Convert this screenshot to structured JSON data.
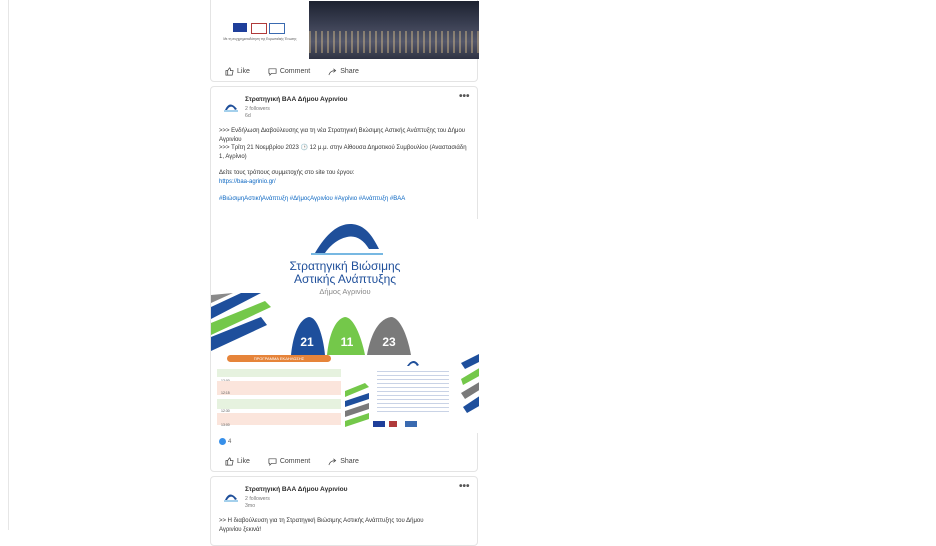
{
  "prev_post": {
    "banner_caption": "Με τη συγχρηματοδότηση της Ευρωπαϊκής Ένωσης",
    "actions": {
      "like": "Like",
      "comment": "Comment",
      "share": "Share"
    }
  },
  "post1": {
    "author": "Στρατηγική ΒΑΑ Δήμου Αγρινίου",
    "followers": "2 followers",
    "time": "6d",
    "menu": "•••",
    "lines": [
      ">>> Ενδήλωση Διαβούλευσης για τη νέα Στρατηγική Βιώσιμης Αστικής Ανάπτυξης του Δήμου Αγρινίου",
      ">>> Τρίτη 21 Νοεμβρίου 2023 🕒 12 μ.μ. στην Αίθουσα Δημοτικού Συμβουλίου (Αναστασιάδη 1, Αγρίνιο)",
      "Δείτε τους τρόπους συμμετοχής στο site του έργου:"
    ],
    "link": "https://baa-agrinio.gr/",
    "hashtags": "#ΒιώσιμηΑστικήΑνάπτυξη #ΔήμοςΑγρινίου #Αγρίνιο #Ανάπτυξη #ΒΑΑ",
    "image": {
      "title_line1": "Στρατηγική Βιώσιμης",
      "title_line2": "Αστικής Ανάπτυξης",
      "subtitle": "Δήμος Αγρινίου",
      "date_badges": [
        "21",
        "11",
        "23"
      ],
      "program_header": "ΠΡΟΓΡΑΜΜΑ ΕΚΔΗΛΩΣΗΣ",
      "program_rows": [
        "12:00",
        "12:15",
        "12:30",
        "13:00"
      ]
    },
    "reactions_count": "4",
    "actions": {
      "like": "Like",
      "comment": "Comment",
      "share": "Share"
    }
  },
  "post2": {
    "author": "Στρατηγική ΒΑΑ Δήμου Αγρινίου",
    "followers": "2 followers",
    "time": "3mo",
    "menu": "•••",
    "line": ">> Η διαβούλευση για τη Στρατηγική Βιώσιμης Αστικής Ανάπτυξης του Δήμου",
    "line_tail": "Αγρινίου ξεκινά!"
  },
  "colors": {
    "brand_blue": "#1f4f9a",
    "badge_blue": "#1e4f9c",
    "badge_green": "#74c84a",
    "badge_gray": "#7a7a7a",
    "link": "#0a66c2"
  }
}
